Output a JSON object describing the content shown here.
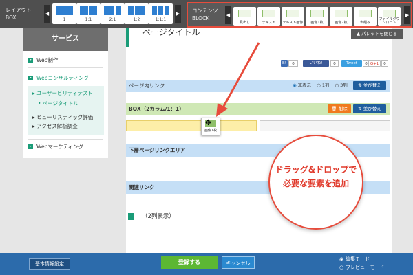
{
  "toolbar": {
    "layout_label_1": "レイアウト",
    "layout_label_2": "BOX",
    "content_label_1": "コンテンツ",
    "content_label_2": "BLOCK",
    "layouts": [
      {
        "label": "1",
        "cols": 1
      },
      {
        "label": "1:1",
        "cols": 2
      },
      {
        "label": "2:1",
        "cols": 2
      },
      {
        "label": "1:2",
        "cols": 2
      },
      {
        "label": "1:1:1",
        "cols": 3
      }
    ],
    "blocks": [
      {
        "label": "見出し",
        "icon": "heading-icon"
      },
      {
        "label": "テキスト",
        "icon": "text-icon"
      },
      {
        "label": "テキスト画像",
        "icon": "text-image-icon"
      },
      {
        "label": "画像1枚",
        "icon": "image-one-icon"
      },
      {
        "label": "画像2枚",
        "icon": "image-two-icon"
      },
      {
        "label": "表組み",
        "icon": "table-icon"
      },
      {
        "label": "ファイルダウンロード",
        "icon": "file-download-icon"
      }
    ],
    "prev_arrow": "◀",
    "next_arrow": "▶"
  },
  "sidebar": {
    "title": "サービス",
    "items": [
      {
        "label": "Web制作"
      },
      {
        "label": "Webコンサルティング"
      },
      {
        "label": "Webマーケティング"
      }
    ],
    "sub_items": [
      {
        "label": "▸ ユーザービリティテスト"
      },
      {
        "label": "• ページタイトル"
      },
      {
        "label": "▸ ヒューリスティック評価"
      },
      {
        "label": "▸ アクセス解析調査"
      }
    ]
  },
  "main": {
    "page_title": "ページタイトル",
    "close_palette": "▲ パレットを閉じる",
    "share": {
      "b_count": "0",
      "like_label": "いいね!",
      "like_count": "0",
      "tweet_label": "Tweet",
      "tweet_count": "0",
      "gplus_label": "G+1",
      "gplus_count": "0"
    },
    "page_link_label": "ページ内リンク",
    "radio_options": [
      "非表示",
      "1列",
      "3列"
    ],
    "sort_label": "⇅ 並び替え",
    "box_label": "BOX（2カラム/1：1）",
    "delete_label": "🗑 削除",
    "drag_item_label": "画像1枚",
    "lower_link_label": "下層ページリンクエリア",
    "related_link_label": "関連リンク",
    "two_col_text": "（2列表示）"
  },
  "callout": {
    "line1": "ドラッグ&ドロップで",
    "line2": "必要な要素を追加"
  },
  "footer": {
    "basic_info": "基本情報設定",
    "save": "登録する",
    "cancel": "キャンセル",
    "edit_mode": "編集モード",
    "preview_mode": "プレビューモード"
  },
  "colors": {
    "accent_green": "#1a9c78",
    "highlight_red": "#e74c3c",
    "footer_blue": "#2c6bab",
    "save_green": "#5cb733"
  }
}
